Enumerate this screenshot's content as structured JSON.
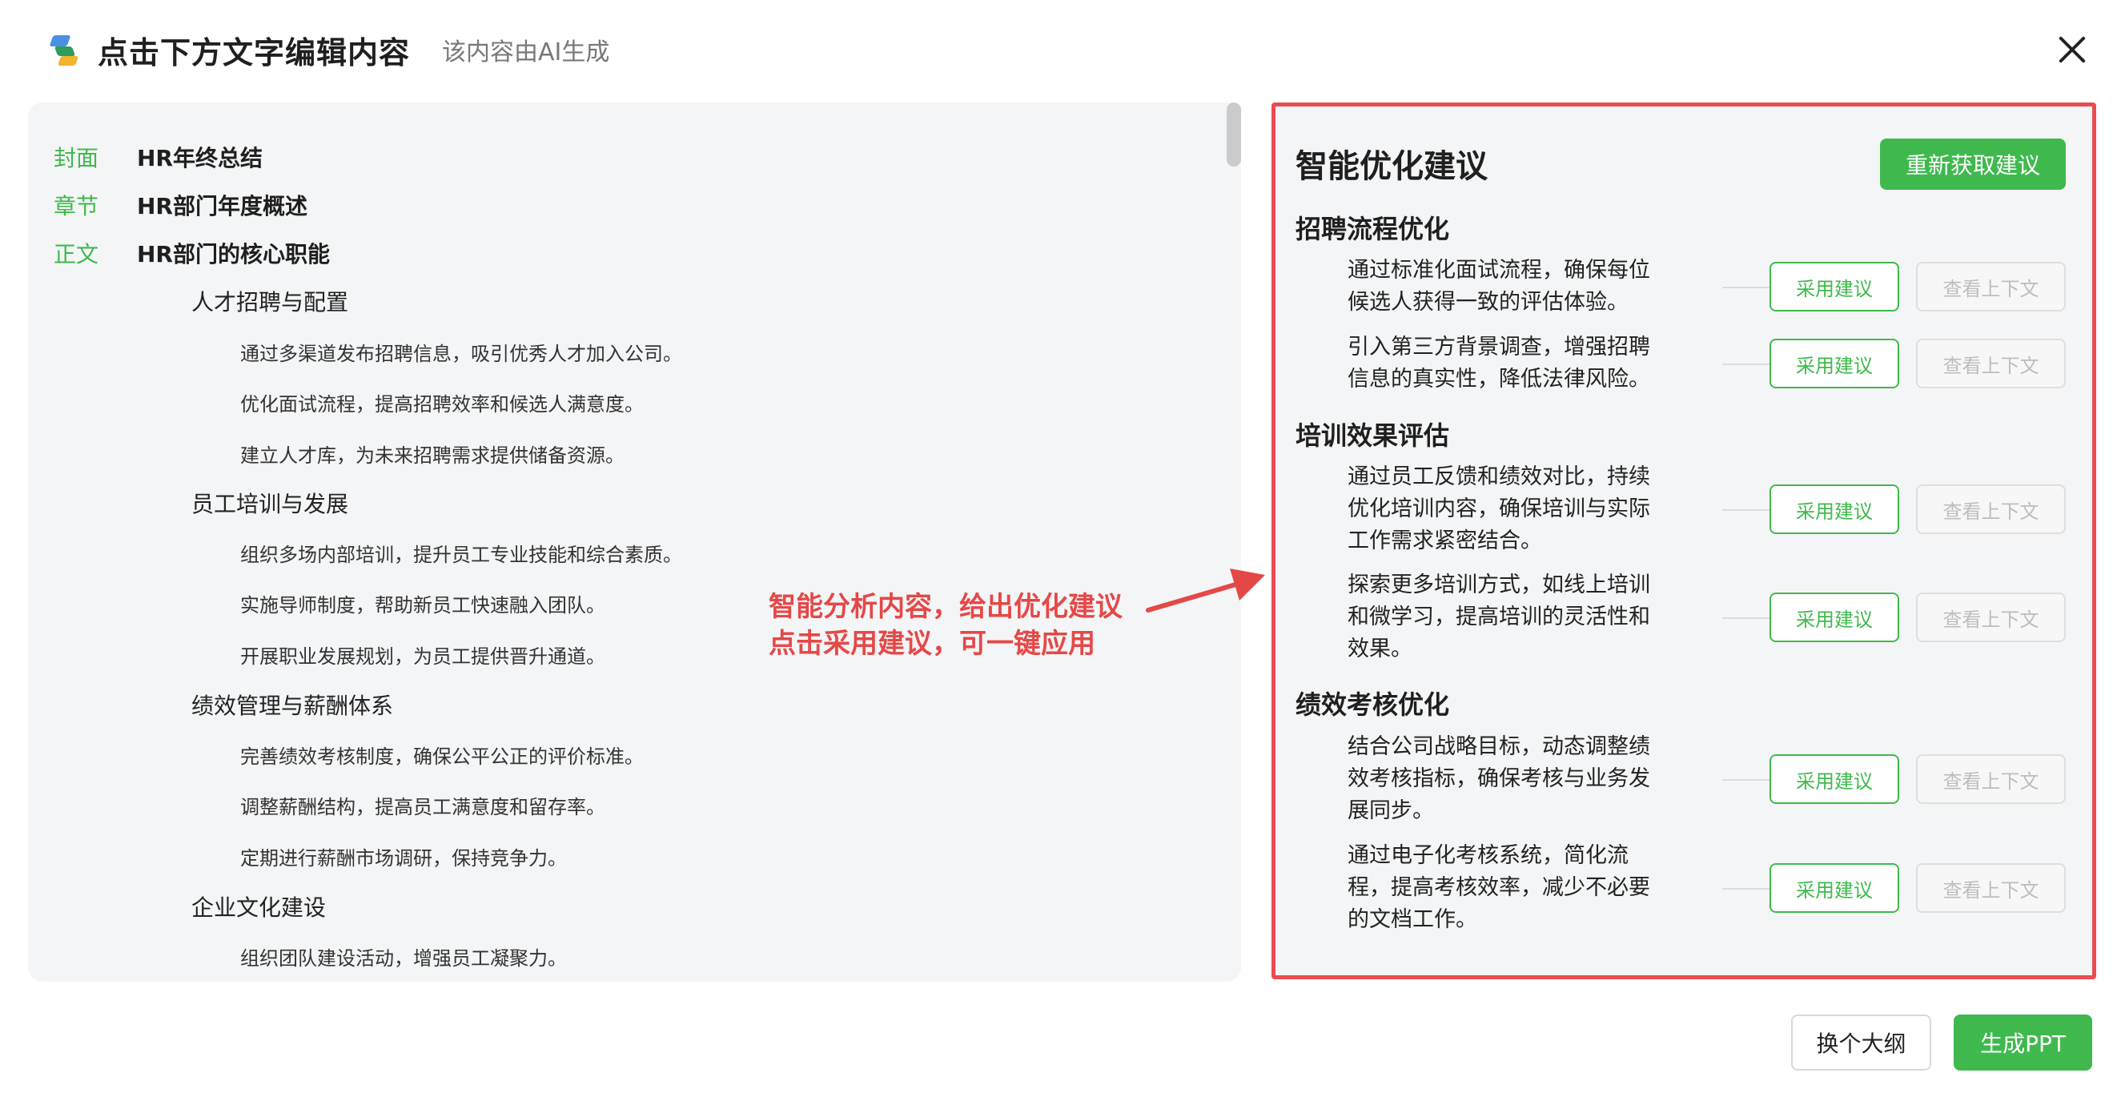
{
  "header": {
    "title": "点击下方文字编辑内容",
    "subtitle": "该内容由AI生成"
  },
  "outline": {
    "cover": {
      "tag": "封面",
      "text": "HR年终总结"
    },
    "chapter": {
      "tag": "章节",
      "text": "HR部门年度概述"
    },
    "body": {
      "tag": "正文",
      "text": "HR部门的核心职能"
    },
    "sections": [
      {
        "title": "人才招聘与配置",
        "items": [
          "通过多渠道发布招聘信息，吸引优秀人才加入公司。",
          "优化面试流程，提高招聘效率和候选人满意度。",
          "建立人才库，为未来招聘需求提供储备资源。"
        ]
      },
      {
        "title": "员工培训与发展",
        "items": [
          "组织多场内部培训，提升员工专业技能和综合素质。",
          "实施导师制度，帮助新员工快速融入团队。",
          "开展职业发展规划，为员工提供晋升通道。"
        ]
      },
      {
        "title": "绩效管理与薪酬体系",
        "items": [
          "完善绩效考核制度，确保公平公正的评价标准。",
          "调整薪酬结构，提高员工满意度和留存率。",
          "定期进行薪酬市场调研，保持竞争力。"
        ]
      },
      {
        "title": "企业文化建设",
        "items": [
          "组织团队建设活动，增强员工凝聚力。"
        ]
      }
    ]
  },
  "annotation": {
    "line1": "智能分析内容，给出优化建议",
    "line2": "点击采用建议，可一键应用",
    "color": "#e54848"
  },
  "suggestions": {
    "title": "智能优化建议",
    "refresh_label": "重新获取建议",
    "adopt_label": "采用建议",
    "context_label": "查看上下文",
    "groups": [
      {
        "title": "招聘流程优化",
        "items": [
          "通过标准化面试流程，确保每位候选人获得一致的评估体验。",
          "引入第三方背景调查，增强招聘信息的真实性，降低法律风险。"
        ]
      },
      {
        "title": "培训效果评估",
        "items": [
          "通过员工反馈和绩效对比，持续优化培训内容，确保培训与实际工作需求紧密结合。",
          "探索更多培训方式，如线上培训和微学习，提高培训的灵活性和效果。"
        ]
      },
      {
        "title": "绩效考核优化",
        "items": [
          "结合公司战略目标，动态调整绩效考核指标，确保考核与业务发展同步。",
          "通过电子化考核系统，简化流程，提高考核效率，减少不必要的文档工作。"
        ]
      }
    ]
  },
  "footer": {
    "switch_label": "换个大纲",
    "generate_label": "生成PPT"
  },
  "colors": {
    "accent": "#3fb94d",
    "highlight_border": "#ea4c50",
    "panel_bg": "#f4f5f6"
  }
}
